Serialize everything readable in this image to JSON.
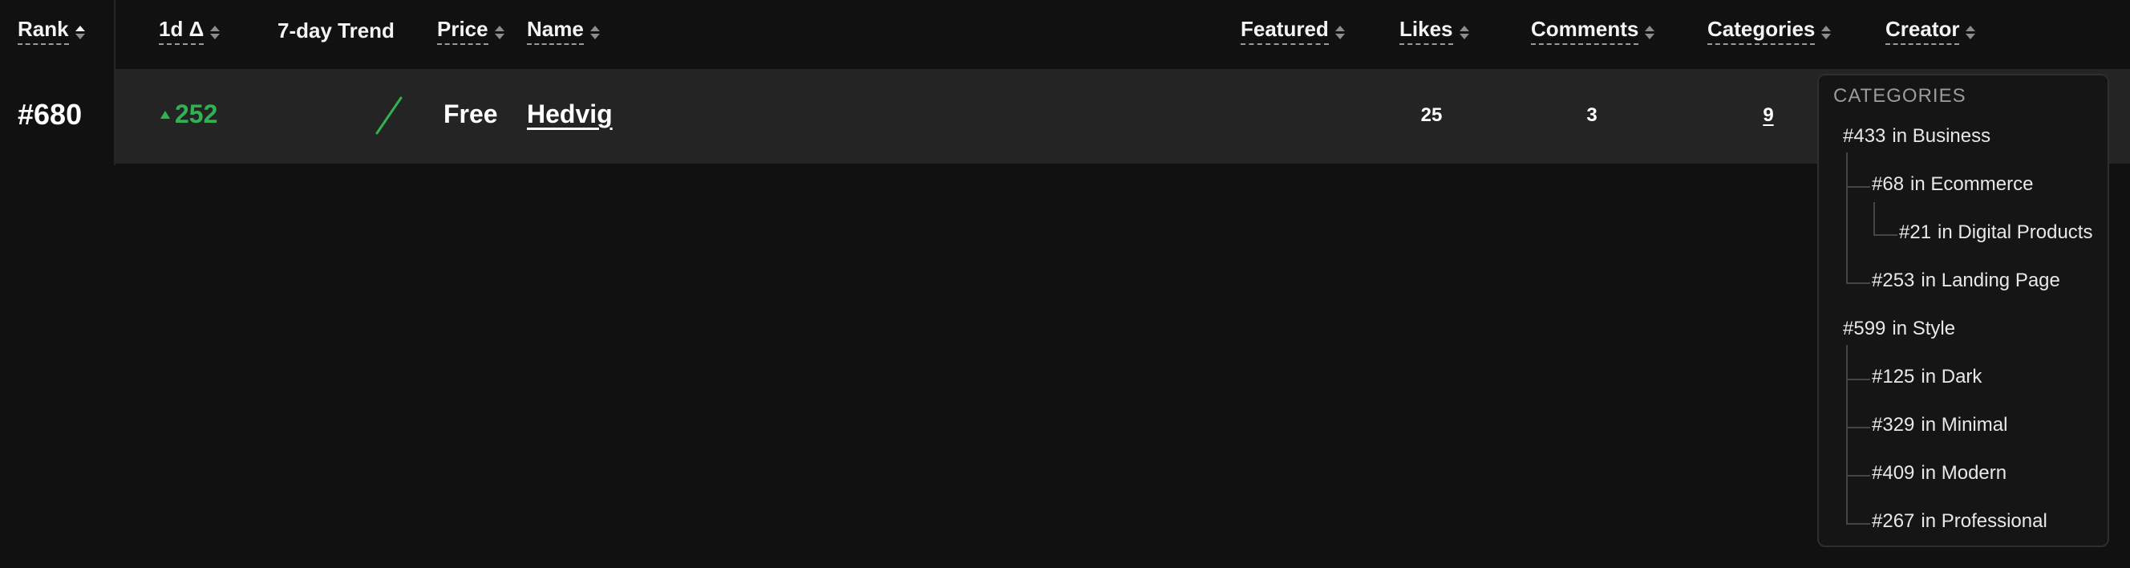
{
  "headers": {
    "rank": "Rank",
    "delta": "1d Δ",
    "trend": "7-day Trend",
    "price": "Price",
    "name": "Name",
    "featured": "Featured",
    "likes": "Likes",
    "comments": "Comments",
    "categories": "Categories",
    "creator": "Creator"
  },
  "row": {
    "rank": "#680",
    "delta": "252",
    "price": "Free",
    "name": "Hedvig",
    "likes": "25",
    "comments": "3",
    "categories": "9"
  },
  "colors": {
    "positive": "#2fb352",
    "row_bg": "#242424",
    "page_bg": "#111111"
  },
  "categories_panel": {
    "title": "CATEGORIES",
    "items": [
      {
        "rank": "#433",
        "label": "in Business"
      },
      {
        "rank": "#68",
        "label": "in Ecommerce"
      },
      {
        "rank": "#21",
        "label": "in Digital Products"
      },
      {
        "rank": "#253",
        "label": "in Landing Page"
      },
      {
        "rank": "#599",
        "label": "in Style"
      },
      {
        "rank": "#125",
        "label": "in Dark"
      },
      {
        "rank": "#329",
        "label": "in Minimal"
      },
      {
        "rank": "#409",
        "label": "in Modern"
      },
      {
        "rank": "#267",
        "label": "in Professional"
      }
    ]
  }
}
